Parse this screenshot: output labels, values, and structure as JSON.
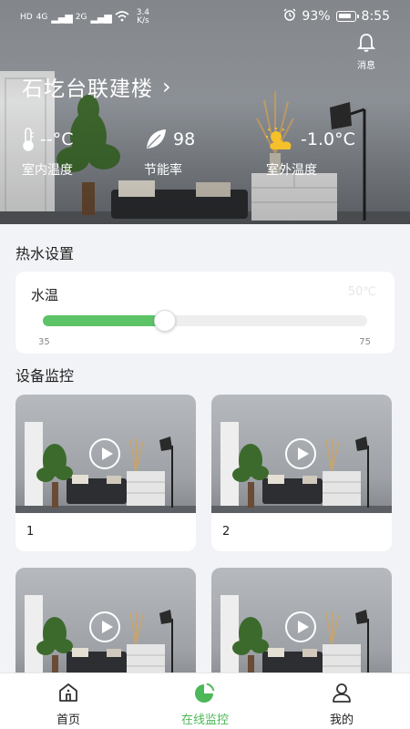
{
  "status_bar": {
    "left_indicators": [
      "HD",
      "4G",
      "2G"
    ],
    "net_speed_value": "3.4",
    "net_speed_unit": "K/s",
    "battery_percent": "93%",
    "time": "8:55"
  },
  "header": {
    "notification_label": "消息",
    "building_name": "石圪台联建楼",
    "building_arrow": "›"
  },
  "stats": {
    "indoor": {
      "value": "--°C",
      "label": "室内温度",
      "icon": "thermometer-icon"
    },
    "saving": {
      "value": "98",
      "label": "节能率",
      "icon": "leaf-icon"
    },
    "outdoor": {
      "value": "-1.0°C",
      "label": "室外温度",
      "icon": "partly-sunny-icon"
    }
  },
  "hot_water": {
    "section_title": "热水设置",
    "item_name": "水温",
    "current_value": "50℃",
    "min_label": "35",
    "max_label": "75",
    "min": 35,
    "max": 75,
    "value": 50,
    "fill_color": "#5cc366"
  },
  "devices": {
    "section_title": "设备监控",
    "items": [
      {
        "name": "1"
      },
      {
        "name": "2"
      },
      {
        "name": ""
      },
      {
        "name": ""
      }
    ]
  },
  "tabbar": {
    "tabs": [
      {
        "label": "首页",
        "icon": "home-icon"
      },
      {
        "label": "在线监控",
        "icon": "pie-chart-icon",
        "active": true
      },
      {
        "label": "我的",
        "icon": "user-icon"
      }
    ],
    "active_color": "#4cb858"
  }
}
